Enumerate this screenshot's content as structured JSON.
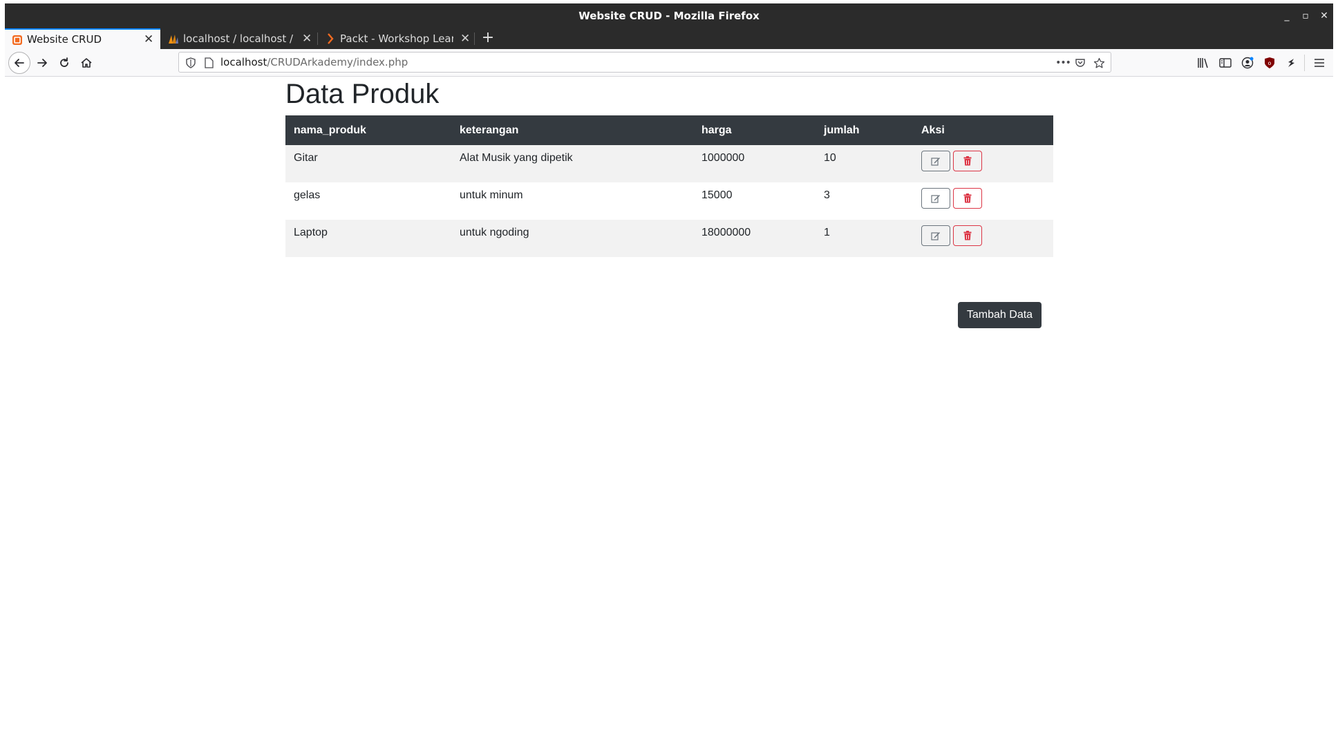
{
  "window": {
    "title": "Website CRUD - Mozilla Firefox",
    "controls": {
      "minimize": "_",
      "maximize": "▫",
      "close": "✕"
    }
  },
  "tabs": [
    {
      "label": "Website CRUD",
      "active": true,
      "icon": "app-favicon"
    },
    {
      "label": "localhost / localhost / db",
      "active": false,
      "icon": "phpmyadmin-favicon"
    },
    {
      "label": "Packt - Workshop Learnin",
      "active": false,
      "icon": "packt-favicon"
    }
  ],
  "newtab_label": "+",
  "urlbar": {
    "host": "localhost",
    "path": "/CRUDArkademy/index.php",
    "more": "•••"
  },
  "page": {
    "heading": "Data Produk",
    "columns": [
      "nama_produk",
      "keterangan",
      "harga",
      "jumlah",
      "Aksi"
    ],
    "rows": [
      {
        "nama_produk": "Gitar",
        "keterangan": "Alat Musik yang dipetik",
        "harga": "1000000",
        "jumlah": "10"
      },
      {
        "nama_produk": "gelas",
        "keterangan": "untuk minum",
        "harga": "15000",
        "jumlah": "3"
      },
      {
        "nama_produk": "Laptop",
        "keterangan": "untuk ngoding",
        "harga": "18000000",
        "jumlah": "1"
      }
    ],
    "add_button": "Tambah Data"
  },
  "colors": {
    "titlebar": "#2b2b2b",
    "table_header": "#343a40",
    "delete": "#dc3545",
    "edit": "#6c757d",
    "accent_tab": "#0a84ff"
  }
}
